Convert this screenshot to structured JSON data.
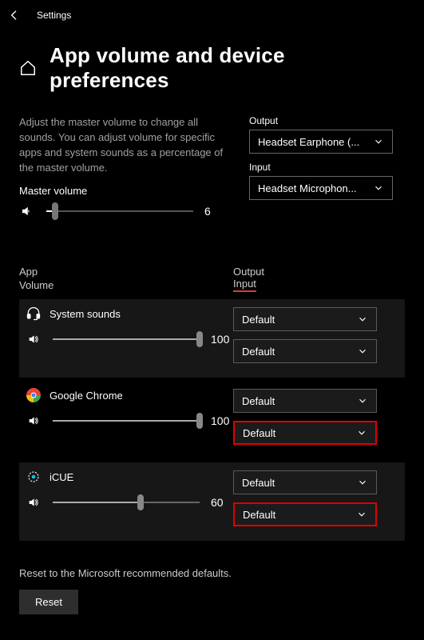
{
  "titlebar": {
    "label": "Settings"
  },
  "page": {
    "title": "App volume and device preferences"
  },
  "desc": "Adjust the master volume to change all sounds. You can adjust volume for specific apps and system sounds as a percentage of the master volume.",
  "master": {
    "label": "Master volume",
    "value": "6",
    "pct": 6
  },
  "global": {
    "output_label": "Output",
    "input_label": "Input",
    "output_value": "Headset Earphone (...",
    "input_value": "Headset Microphon..."
  },
  "columns": {
    "left1": "App",
    "left2": "Volume",
    "right1": "Output",
    "right2": "Input"
  },
  "apps": [
    {
      "name": "System sounds",
      "volume": "100",
      "pct": 100,
      "output": "Default",
      "input": "Default",
      "shade": true,
      "icon": "headset",
      "hl_input": false
    },
    {
      "name": "Google Chrome",
      "volume": "100",
      "pct": 100,
      "output": "Default",
      "input": "Default",
      "shade": false,
      "icon": "chrome",
      "hl_input": true
    },
    {
      "name": "iCUE",
      "volume": "60",
      "pct": 60,
      "output": "Default",
      "input": "Default",
      "shade": true,
      "icon": "icue",
      "hl_input": true
    }
  ],
  "reset": {
    "text": "Reset to the Microsoft recommended defaults.",
    "button": "Reset"
  }
}
